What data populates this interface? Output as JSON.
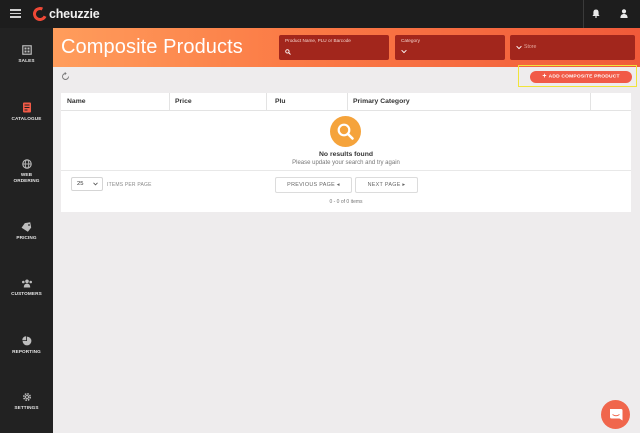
{
  "app": {
    "name": "cheuzzie"
  },
  "sidebar": {
    "items": [
      {
        "label": "SALES",
        "icon": "sales-icon"
      },
      {
        "label": "CATALOGUE",
        "icon": "catalogue-icon",
        "active": true
      },
      {
        "label": "WEB ORDERING",
        "icon": "globe-icon"
      },
      {
        "label": "PRICING",
        "icon": "tag-icon"
      },
      {
        "label": "CUSTOMERS",
        "icon": "customers-icon"
      },
      {
        "label": "REPORTING",
        "icon": "pie-chart-icon"
      },
      {
        "label": "SETTINGS",
        "icon": "gear-icon"
      }
    ]
  },
  "header": {
    "title": "Composite Products",
    "search_placeholder": "Product Name, PLU or Barcode",
    "category_label": "Category",
    "store_placeholder": "Store"
  },
  "actions": {
    "add_label": "ADD COMPOSITE PRODUCT"
  },
  "table": {
    "columns": [
      "Name",
      "Price",
      "Plu",
      "Primary Category"
    ],
    "empty_title": "No results found",
    "empty_subtitle": "Please update your search and try again"
  },
  "pagination": {
    "per_page_value": "25",
    "per_page_label": "ITEMS PER PAGE",
    "previous_label": "PREVIOUS PAGE ◂",
    "next_label": "NEXT PAGE ▸",
    "count_text": "0 - 0 of 0 items"
  },
  "colors": {
    "accent": "#f15a47",
    "header_gradient_start": "#ff9d5c",
    "header_gradient_end": "#f05a3a",
    "filter_bg": "#a2261c",
    "highlight": "#f0e43a",
    "empty_icon": "#f5a33b"
  }
}
